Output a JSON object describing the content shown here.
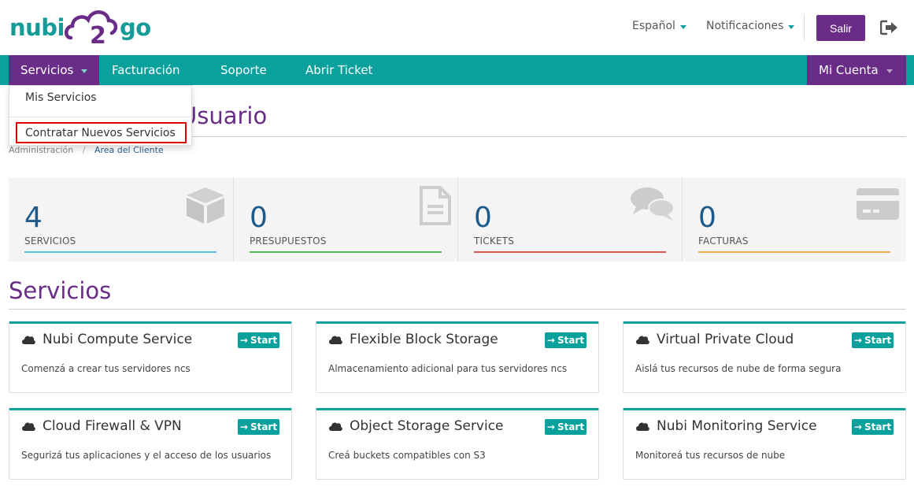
{
  "brand": {
    "logo_left": "nubi",
    "logo_mid": "2",
    "logo_right": "go",
    "color_teal": "#159c98",
    "color_purple": "#6a2d87"
  },
  "header": {
    "language_label": "Español",
    "notifications_label": "Notificaciones",
    "logout_button": "Salir"
  },
  "nav": {
    "items": [
      {
        "label": "Servicios"
      },
      {
        "label": "Facturación"
      },
      {
        "label": "Soporte"
      },
      {
        "label": "Abrir Ticket"
      }
    ],
    "account_label": "Mi Cuenta",
    "bar_color": "#0aa09c"
  },
  "dropdown": {
    "items": [
      {
        "label": "Mis Servicios"
      },
      {
        "label": "Contratar Nuevos Servicios"
      }
    ]
  },
  "page": {
    "title_visible": "Usuario",
    "breadcrumb": [
      "Administración",
      "Area del Cliente"
    ]
  },
  "stats": [
    {
      "value": "4",
      "label": "SERVICIOS",
      "color": "#5bc0de",
      "icon": "cube-icon"
    },
    {
      "value": "0",
      "label": "PRESUPUESTOS",
      "color": "#5cb85c",
      "icon": "document-icon"
    },
    {
      "value": "0",
      "label": "TICKETS",
      "color": "#d9534f",
      "icon": "chat-icon"
    },
    {
      "value": "0",
      "label": "FACTURAS",
      "color": "#f0ad4e",
      "icon": "credit-card-icon"
    }
  ],
  "services": {
    "title": "Servicios",
    "start_label": "Start",
    "cards": [
      {
        "title": "Nubi Compute Service",
        "desc": "Comenzá a crear tus servidores ncs"
      },
      {
        "title": "Flexible Block Storage",
        "desc": "Almacenamiento adicional para tus servidores ncs"
      },
      {
        "title": "Virtual Private Cloud",
        "desc": "Aislá tus recursos de nube de forma segura"
      },
      {
        "title": "Cloud Firewall & VPN",
        "desc": "Segurizá tus aplicaciones y el acceso de los usuarios"
      },
      {
        "title": "Object Storage Service",
        "desc": "Creá buckets compatibles con S3"
      },
      {
        "title": "Nubi Monitoring Service",
        "desc": "Monitoreá tus recursos de nube"
      }
    ]
  }
}
